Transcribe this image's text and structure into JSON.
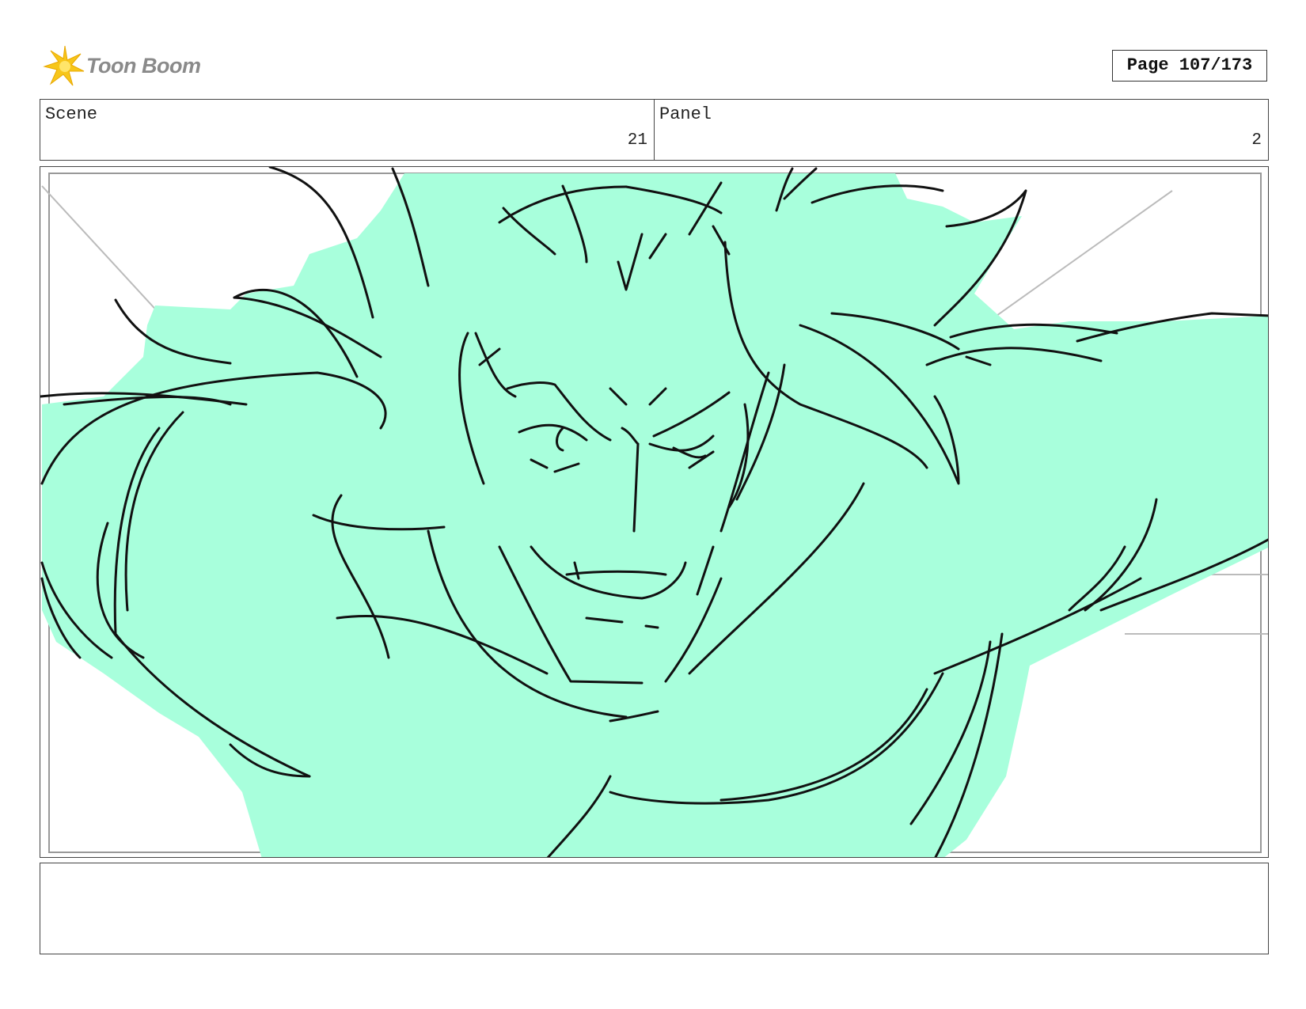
{
  "header": {
    "logo_text": "Toon Boom",
    "logo_icon": "toon-boom-star-icon",
    "page_label": "Page 107/173"
  },
  "info": {
    "scene_label": "Scene",
    "scene_value": "21",
    "panel_label": "Panel",
    "panel_value": "2"
  },
  "drawing": {
    "fill_color": "#a8ffdc",
    "line_color": "#111111",
    "guide_color": "#bbbbbb"
  },
  "notes": {
    "text": ""
  }
}
